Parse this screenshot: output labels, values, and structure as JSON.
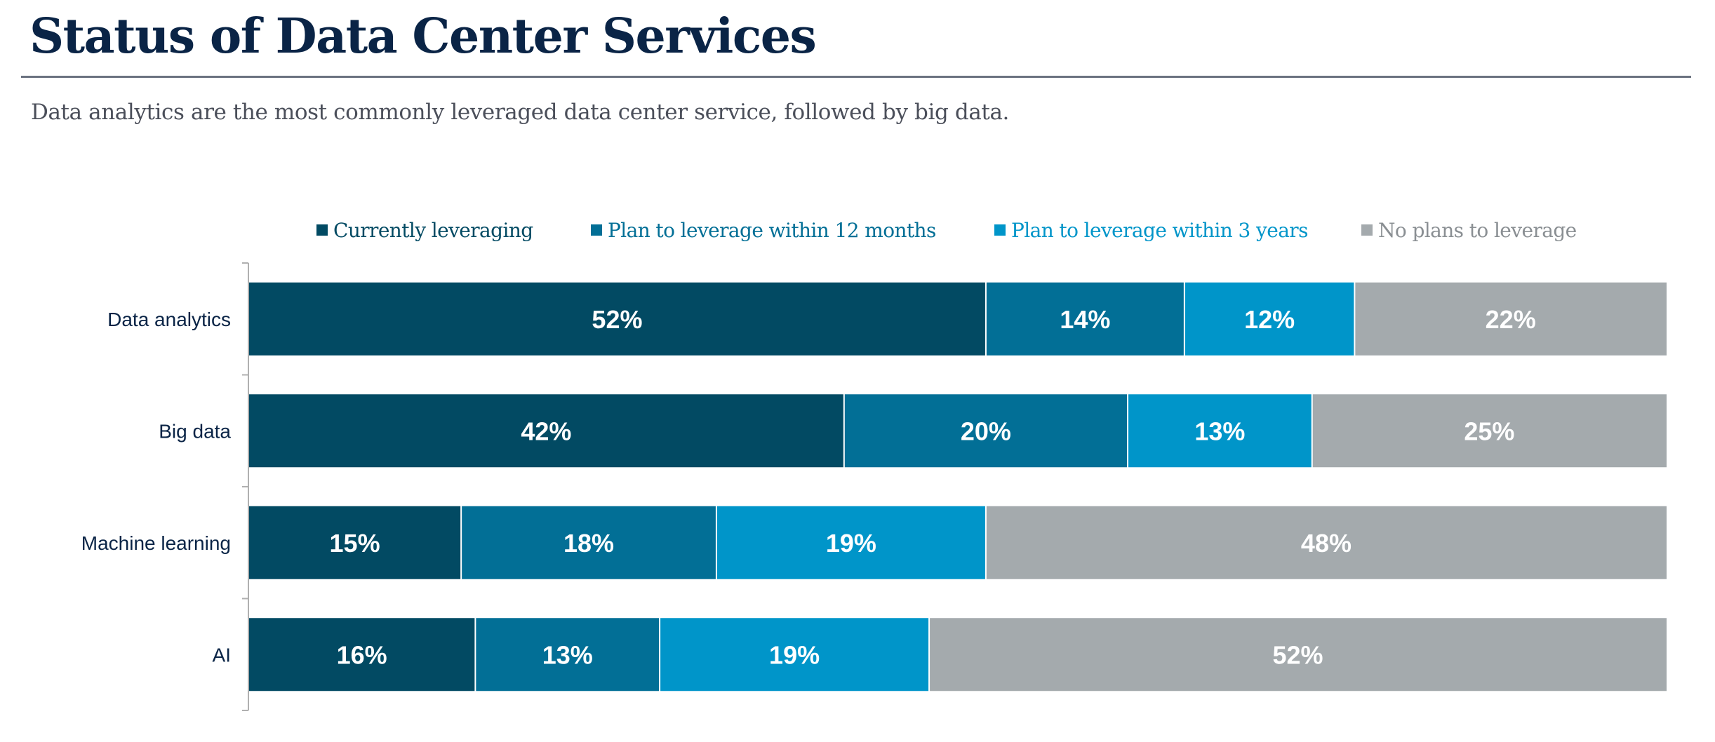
{
  "header": {
    "title": "Status of Data Center Services",
    "subtitle": "Data analytics are the most commonly leveraged data center service, followed by big data."
  },
  "chart_data": {
    "type": "bar",
    "orientation": "horizontal",
    "stacked": true,
    "title": "Status of Data Center Services",
    "subtitle": "Data analytics are the most commonly leveraged data center service, followed by big data.",
    "xlabel": "",
    "ylabel": "",
    "xlim": [
      0,
      100
    ],
    "unit": "%",
    "grid": false,
    "legend_position": "top",
    "categories": [
      "Data analytics",
      "Big data",
      "Machine learning",
      "AI"
    ],
    "series": [
      {
        "name": "Currently leveraging",
        "color": "#024a63",
        "text_color": "#024a63",
        "values": [
          52,
          42,
          15,
          16
        ],
        "labels": [
          "52%",
          "42%",
          "15%",
          "16%"
        ]
      },
      {
        "name": "Plan to leverage within 12 months",
        "color": "#026f96",
        "text_color": "#026f96",
        "values": [
          14,
          20,
          18,
          13
        ],
        "labels": [
          "14%",
          "20%",
          "18%",
          "13%"
        ]
      },
      {
        "name": "Plan to leverage within 3 years",
        "color": "#0095c9",
        "text_color": "#0095c9",
        "values": [
          12,
          13,
          19,
          19
        ],
        "labels": [
          "12%",
          "13%",
          "19%",
          "19%"
        ]
      },
      {
        "name": "No plans to leverage",
        "color": "#a4aaad",
        "text_color": "#8a8f93",
        "values": [
          22,
          25,
          48,
          52
        ],
        "labels": [
          "22%",
          "25%",
          "48%",
          "52%"
        ]
      }
    ]
  }
}
